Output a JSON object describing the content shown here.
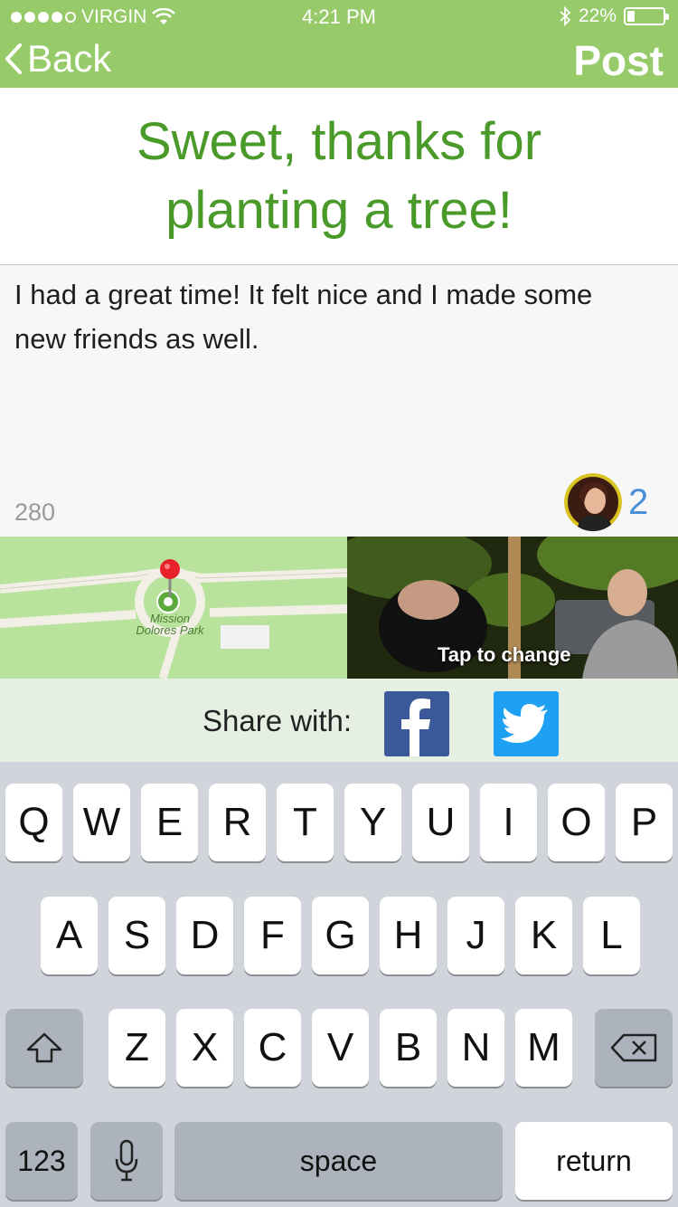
{
  "status_bar": {
    "carrier": "VIRGIN",
    "time": "4:21 PM",
    "battery": "22%",
    "battery_level": 0.22,
    "signal_bars": 4
  },
  "nav": {
    "back_label": "Back",
    "post_label": "Post"
  },
  "title": "Sweet, thanks for planting a tree!",
  "compose": {
    "text": "I had a great time! It felt nice and I made some new friends as well.",
    "char_count": "280",
    "friends_count": "2"
  },
  "map": {
    "place_label_line1": "Mission",
    "place_label_line2": "Dolores Park"
  },
  "photo": {
    "caption": "Tap to change"
  },
  "share": {
    "label": "Share with:",
    "facebook_icon": "facebook-icon",
    "twitter_icon": "twitter-icon"
  },
  "keyboard": {
    "row1": [
      "Q",
      "W",
      "E",
      "R",
      "T",
      "Y",
      "U",
      "I",
      "O",
      "P"
    ],
    "row2": [
      "A",
      "S",
      "D",
      "F",
      "G",
      "H",
      "J",
      "K",
      "L"
    ],
    "row3": [
      "Z",
      "X",
      "C",
      "V",
      "B",
      "N",
      "M"
    ],
    "numbers_label": "123",
    "space_label": "space",
    "return_label": "return",
    "shift_icon": "shift-icon",
    "delete_icon": "delete-icon",
    "mic_icon": "mic-icon"
  },
  "colors": {
    "header_green": "#97cb69",
    "title_green": "#4a9a2a",
    "friends_blue": "#4a90d9",
    "facebook_blue": "#3b5998",
    "twitter_blue": "#1ea1f2"
  }
}
